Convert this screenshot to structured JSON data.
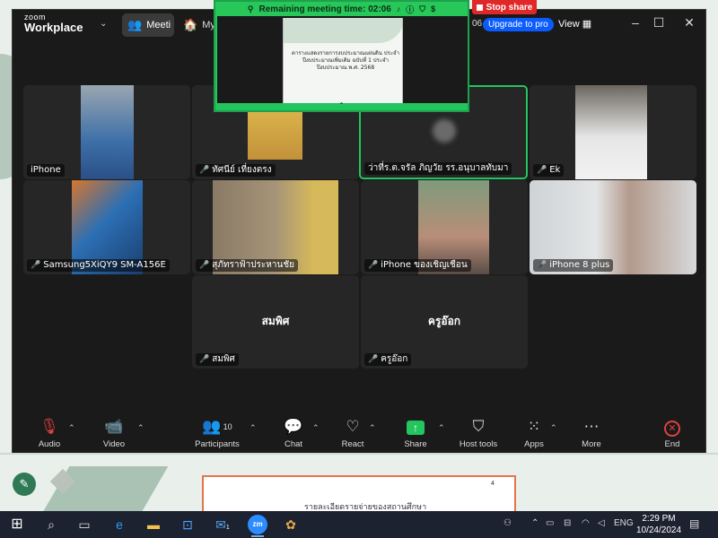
{
  "app": {
    "logo_line1": "zoom",
    "logo_line2": "Workplace",
    "tabs": [
      {
        "label": "Meeti",
        "icon": "meeting-icon"
      },
      {
        "label": "My",
        "icon": "home-icon"
      }
    ],
    "time_fragment": "06",
    "upgrade_label": "Upgrade to pro",
    "view_label": "View"
  },
  "timer": {
    "text": "Remaining meeting time: 02:06",
    "slide_text": "ตารางแสดงรายการงบประมาณแผ่นดิน ประจำปีงบประมาณเพิ่มเติม ฉบับที่ 1 ประจำปีงบประมาณ พ.ศ. 2568"
  },
  "stop_share_label": "Stop share",
  "participants": [
    {
      "name": "iPhone",
      "muted": false
    },
    {
      "name": "ทัศนีย์ เที่ยงตรง",
      "muted": true
    },
    {
      "name": "ว่าที่ร.ต.จรัล ภิญวัย รร.อนุบาลทับมา",
      "muted": false,
      "active": true
    },
    {
      "name": "Ek",
      "muted": true
    },
    {
      "name": "Samsung5XiQY9 SM-A156E",
      "muted": true
    },
    {
      "name": "สุภัทราฟ้าประหานชัย",
      "muted": true
    },
    {
      "name": "iPhone ของเชิญเชือน",
      "muted": true
    },
    {
      "name": "iPhone 8 plus",
      "muted": true
    },
    {
      "name": "สมพิศ",
      "display": "สมพิศ",
      "muted": true
    },
    {
      "name": "ครูอ๊อก",
      "display": "ครูอ๊อก",
      "muted": true
    }
  ],
  "toolbar": {
    "audio": "Audio",
    "video": "Video",
    "participants": "Participants",
    "participants_count": "10",
    "chat": "Chat",
    "react": "React",
    "share": "Share",
    "host_tools": "Host tools",
    "apps": "Apps",
    "more": "More",
    "end": "End"
  },
  "document": {
    "heading": "รายละเอียดรายจ่ายของสถานศึกษา",
    "mark": "4"
  },
  "taskbar": {
    "lang": "ENG",
    "time": "2:29 PM",
    "date": "10/24/2024",
    "mail_badge": "1"
  },
  "colors": {
    "accent_green": "#22c55e",
    "stop_red": "#e02828",
    "upgrade_blue": "#0b5cff",
    "mic_muted": "#e54848"
  }
}
